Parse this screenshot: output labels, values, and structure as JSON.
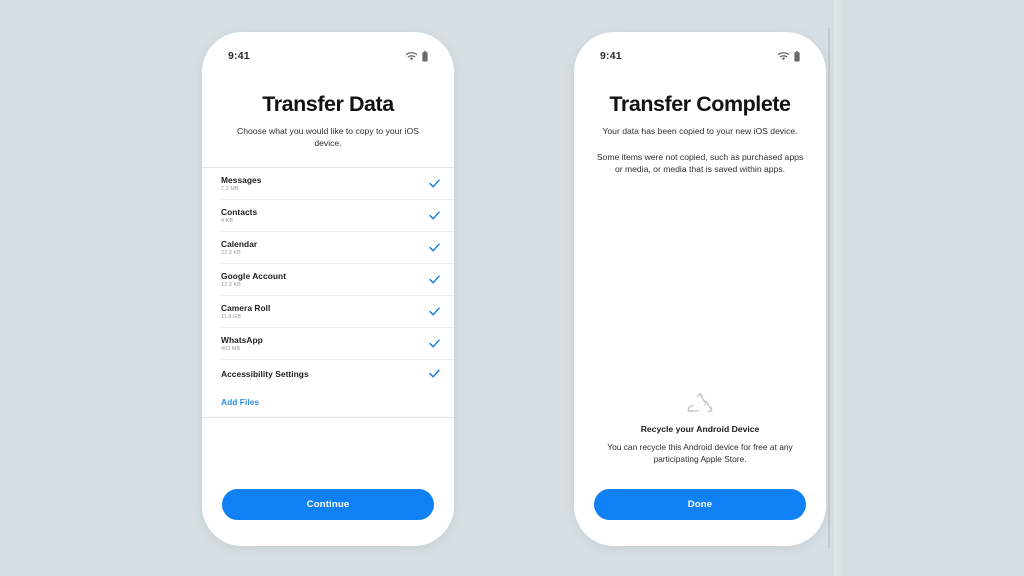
{
  "theme": {
    "background": "#d7dfe4",
    "accent": "#1080f5",
    "link": "#2f8fdc",
    "check": "#1a7fe0",
    "text": "#1c1c1c",
    "muted": "#9b9b9b"
  },
  "phone_left": {
    "status_bar": {
      "time": "9:41",
      "wifi_icon": "wifi-icon",
      "battery_icon": "battery-full-icon"
    },
    "title": "Transfer Data",
    "subtitle": "Choose what you would like to copy to your iOS device.",
    "list": [
      {
        "label": "Messages",
        "size": "7.2 MB",
        "checked": true
      },
      {
        "label": "Contacts",
        "size": "4 KB",
        "checked": true
      },
      {
        "label": "Calendar",
        "size": "22.3 KB",
        "checked": true
      },
      {
        "label": "Google Account",
        "size": "12.3 KB",
        "checked": true
      },
      {
        "label": "Camera Roll",
        "size": "11.8 GB",
        "checked": true
      },
      {
        "label": "WhatsApp",
        "size": "463 MB",
        "checked": true
      },
      {
        "label": "Accessibility Settings",
        "size": "",
        "checked": true
      }
    ],
    "add_files_label": "Add Files",
    "cta_label": "Continue"
  },
  "phone_right": {
    "status_bar": {
      "time": "9:41",
      "wifi_icon": "wifi-icon",
      "battery_icon": "battery-full-icon"
    },
    "title": "Transfer Complete",
    "subtitle": "Your data has been copied to your new iOS device.",
    "note": "Some items were not copied, such as purchased apps or media, or media that is saved within apps.",
    "recycle": {
      "icon": "recycle-icon",
      "title": "Recycle your Android Device",
      "text": "You can recycle this Android device for free at any participating Apple Store."
    },
    "cta_label": "Done"
  }
}
